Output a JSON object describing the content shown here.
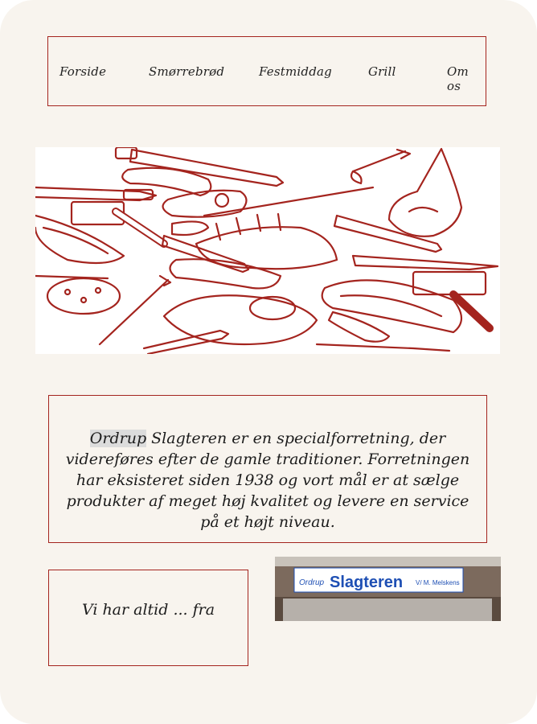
{
  "nav": {
    "items": [
      {
        "label": "Forside"
      },
      {
        "label": "Smørrebrød"
      },
      {
        "label": "Festmiddag"
      },
      {
        "label": "Grill"
      },
      {
        "label": "Om os"
      }
    ]
  },
  "intro": {
    "highlight": "Ordrup",
    "text": " Slagteren er en specialforretning, der videreføres efter de gamle traditioner. Forretningen har eksisteret siden 1938 og vort mål er at sælge produkter af meget høj kvalitet og levere en service på et højt niveau."
  },
  "section2": {
    "text": "Vi har altid ... fra"
  },
  "shop_sign": {
    "small": "Ordrup",
    "big": "Slagteren",
    "sub": "V/ M. Melskens"
  },
  "colors": {
    "accent": "#a4241e",
    "background": "#f8f4ee"
  }
}
